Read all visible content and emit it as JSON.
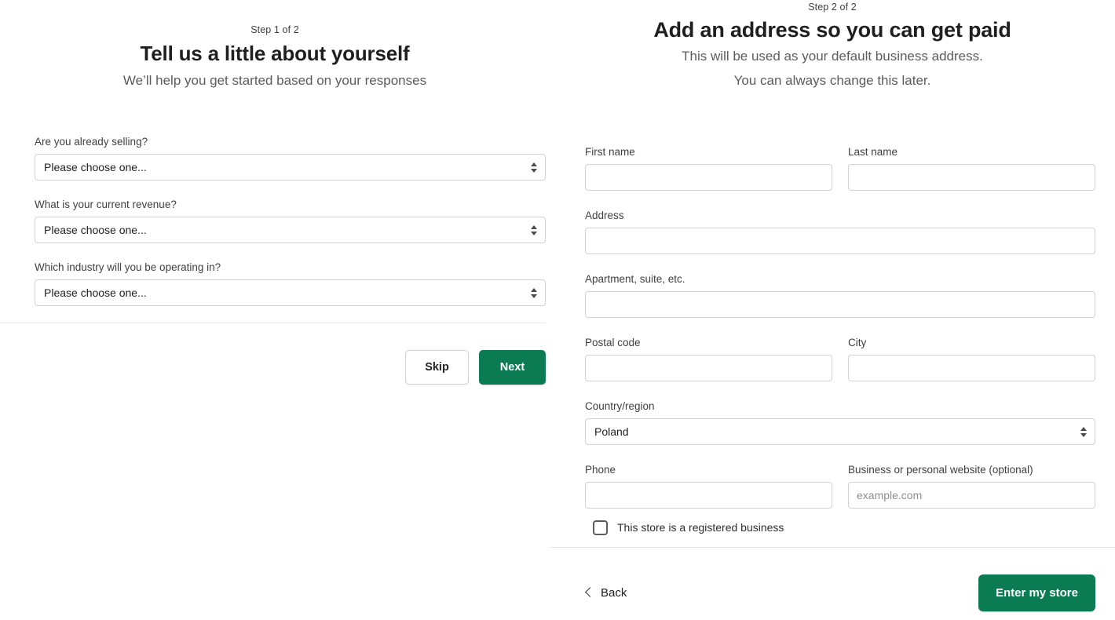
{
  "theme": {
    "accent_green": "#0b7b53",
    "label_color": "#404040",
    "border_color": "#d2d2d2",
    "placeholder_color": "#8f8f8f",
    "page_background": "#ffffff"
  },
  "left_panel": {
    "step_label": "Step 1 of 2",
    "headline": "Tell us a little about yourself",
    "subline": "We’ll help you get started based on your responses",
    "fields": [
      {
        "label": "Are you already selling?",
        "type": "select",
        "value": "Please choose one...",
        "name": "already-selling"
      },
      {
        "label": "What is your current revenue?",
        "type": "select",
        "value": "Please choose one...",
        "name": "current-revenue"
      },
      {
        "label": "Which industry will you be operating in?",
        "type": "select",
        "value": "Please choose one...",
        "name": "industry"
      }
    ],
    "actions": {
      "skip_label": "Skip",
      "next_label": "Next"
    }
  },
  "right_panel": {
    "step_label": "Step 2 of 2",
    "headline": "Add an address so you can get paid",
    "subline_1": "This will be used as your default business address.",
    "subline_2": "You can always change this later.",
    "fields": {
      "first_name": {
        "label": "First name",
        "value": "",
        "placeholder": ""
      },
      "last_name": {
        "label": "Last name",
        "value": "",
        "placeholder": ""
      },
      "address": {
        "label": "Address",
        "value": "",
        "placeholder": ""
      },
      "apartment": {
        "label": "Apartment, suite, etc.",
        "value": "",
        "placeholder": ""
      },
      "postal_code": {
        "label": "Postal code",
        "value": "",
        "placeholder": ""
      },
      "city": {
        "label": "City",
        "value": "",
        "placeholder": ""
      },
      "country": {
        "label": "Country/region",
        "value": "Poland"
      },
      "phone": {
        "label": "Phone",
        "value": "",
        "placeholder": ""
      },
      "website": {
        "label": "Business or personal website (optional)",
        "value": "",
        "placeholder": "example.com"
      }
    },
    "checkbox": {
      "label": "This store is a registered business",
      "checked": false
    },
    "footer": {
      "back_label": "Back",
      "submit_label": "Enter my store"
    }
  }
}
